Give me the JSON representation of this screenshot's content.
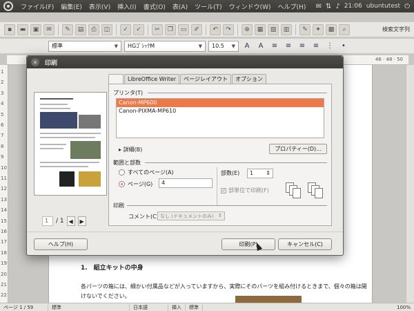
{
  "menubar": {
    "items": [
      "ファイル(F)",
      "編集(E)",
      "表示(V)",
      "挿入(I)",
      "書式(O)",
      "表(A)",
      "ツール(T)",
      "ウィンドウ(W)",
      "ヘルプ(H)"
    ],
    "clock": "21:06",
    "user": "ubuntutest"
  },
  "toolbar": {
    "search_label": "検索文字列"
  },
  "format_bar": {
    "style": "標準",
    "font": "HGｺﾞｼｯｸM",
    "size": "10.5"
  },
  "ruler": {
    "top_text": "46 · 48 · 50",
    "left_numbers": [
      "1",
      "2",
      "3",
      "4",
      "5",
      "6",
      "7",
      "8",
      "9",
      "10",
      "11",
      "12",
      "13",
      "14",
      "15",
      "16",
      "17",
      "18",
      "19",
      "20",
      "21",
      "22"
    ]
  },
  "document": {
    "heading": "1.　組立キットの中身",
    "body": "各パーツの箱には、細かい付属品などが入っていますから、実際にそのパーツを組み付けるときまで、個々の箱は開けないでください。"
  },
  "status": {
    "page": "ページ 1 / 59",
    "style": "標準",
    "language": "日本語",
    "insert": "挿入",
    "standard": "標準",
    "zoom": "100%"
  },
  "dialog": {
    "title": "印刷",
    "tabs": [
      "LibreOffice Writer",
      "ページレイアウト",
      "オプション"
    ],
    "printer_section": "プリンタ(T)",
    "printers": [
      "Canon-MP600",
      "Canon-PIXMA-MP610"
    ],
    "selected_printer": "Canon-MP600",
    "details": "詳細(B)",
    "properties_button": "プロパティー(D)...",
    "range_section": "範囲と部数",
    "all_pages": "すべてのページ(A)",
    "pages_label": "ページ(G)",
    "pages_value": "4",
    "copies_label": "部数(E)",
    "copies_value": "1",
    "collate_label": "部単位で印刷(F)",
    "print_section": "印刷",
    "comment_label": "コメント(C)",
    "comment_value": "なし (ドキュメントのみ)",
    "page_current": "1",
    "page_total": "/ 1",
    "help_button": "ヘルプ(H)",
    "print_button": "印刷(P)",
    "cancel_button": "キャンセル(C)"
  }
}
